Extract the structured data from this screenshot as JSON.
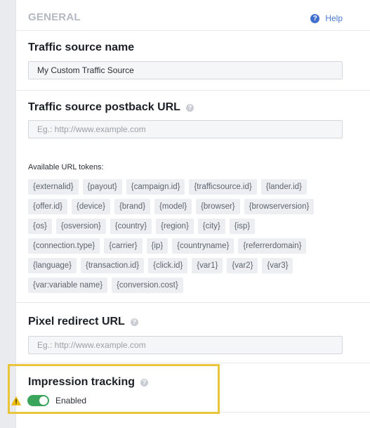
{
  "header": {
    "title": "GENERAL",
    "help_label": "Help"
  },
  "traffic_source_name": {
    "label": "Traffic source name",
    "value": "My Custom Traffic Source"
  },
  "postback_url": {
    "label": "Traffic source postback URL",
    "placeholder": "Eg.: http://www.example.com"
  },
  "tokens": {
    "label": "Available URL tokens:",
    "rows": [
      [
        "{externalid}",
        "{payout}",
        "{campaign.id}",
        "{trafficsource.id}",
        "{lander.id}"
      ],
      [
        "{offer.id}",
        "{device}",
        "{brand}",
        "{model}",
        "{browser}",
        "{browserversion}"
      ],
      [
        "{os}",
        "{osversion}",
        "{country}",
        "{region}",
        "{city}",
        "{isp}"
      ],
      [
        "{connection.type}",
        "{carrier}",
        "{ip}",
        "{countryname}",
        "{referrerdomain}"
      ],
      [
        "{language}",
        "{transaction.id}",
        "{click.id}",
        "{var1}",
        "{var2}",
        "{var3}"
      ],
      [
        "{var:variable name}",
        "{conversion.cost}"
      ]
    ]
  },
  "pixel_redirect": {
    "label": "Pixel redirect URL",
    "placeholder": "Eg.: http://www.example.com"
  },
  "impression_tracking": {
    "label": "Impression tracking",
    "toggle_label": "Enabled",
    "enabled": true
  },
  "colors": {
    "accent_blue": "#3f6fcf",
    "toggle_on": "#3ba55c",
    "highlight": "#e8c53a"
  }
}
